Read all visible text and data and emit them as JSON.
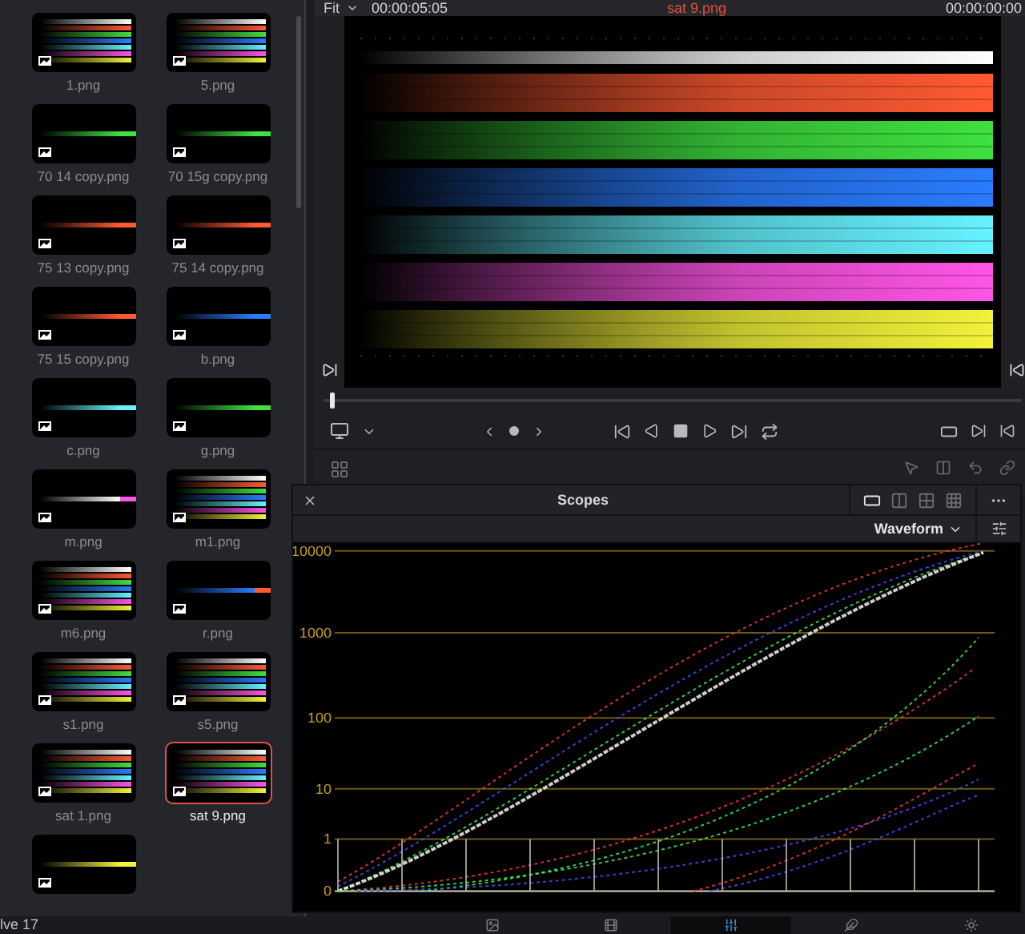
{
  "media_pool": {
    "clips": [
      {
        "label": "1.png",
        "kind": "full",
        "selected": false
      },
      {
        "label": "5.png",
        "kind": "full",
        "selected": false
      },
      {
        "label": "70 14 copy.png",
        "kind": "single",
        "color": "#3fe03f",
        "selected": false
      },
      {
        "label": "70 15g copy.png",
        "kind": "single",
        "color": "#3fe03f",
        "selected": false
      },
      {
        "label": "75 13 copy.png",
        "kind": "single",
        "color": "#ff5a32",
        "selected": false
      },
      {
        "label": "75 14 copy.png",
        "kind": "single",
        "color": "#ff5a32",
        "selected": false
      },
      {
        "label": "75 15 copy.png",
        "kind": "single",
        "color": "#ff5a32",
        "selected": false
      },
      {
        "label": "b.png",
        "kind": "single",
        "color": "#2a7cff",
        "selected": false
      },
      {
        "label": "c.png",
        "kind": "single",
        "color": "#66f2ff",
        "selected": false
      },
      {
        "label": "g.png",
        "kind": "single",
        "color": "#3fe03f",
        "selected": false
      },
      {
        "label": "m.png",
        "kind": "single",
        "color": "#ff55e6",
        "selected": false
      },
      {
        "label": "m1.png",
        "kind": "full",
        "selected": false
      },
      {
        "label": "m6.png",
        "kind": "full",
        "selected": false
      },
      {
        "label": "r.png",
        "kind": "single",
        "color": "#ff5a32",
        "selected": false
      },
      {
        "label": "s1.png",
        "kind": "full",
        "selected": false
      },
      {
        "label": "s5.png",
        "kind": "full",
        "selected": false
      },
      {
        "label": "sat 1.png",
        "kind": "full",
        "selected": false
      },
      {
        "label": "sat 9.png",
        "kind": "full",
        "selected": true
      },
      {
        "kind": "single",
        "color": "#f2f23a",
        "selected": false
      }
    ],
    "status": "lve 17"
  },
  "viewer": {
    "zoom": "Fit",
    "timecode_left": "00:00:05:05",
    "clip_title": "sat 9.png",
    "timecode_right": "00:00:00:00",
    "scrubber": {
      "level": 0.01
    }
  },
  "scopes": {
    "title": "Scopes",
    "layouts": [
      {
        "selected": true
      },
      {
        "selected": false
      },
      {
        "selected": false
      },
      {
        "selected": false
      }
    ],
    "mode": "Waveform",
    "scale_labels": [
      "10000",
      "1000",
      "100",
      "10",
      "1",
      "0"
    ]
  },
  "pages": [
    {
      "selected": false
    },
    {
      "selected": false
    },
    {
      "selected": true
    },
    {
      "selected": false
    },
    {
      "selected": false
    }
  ]
}
